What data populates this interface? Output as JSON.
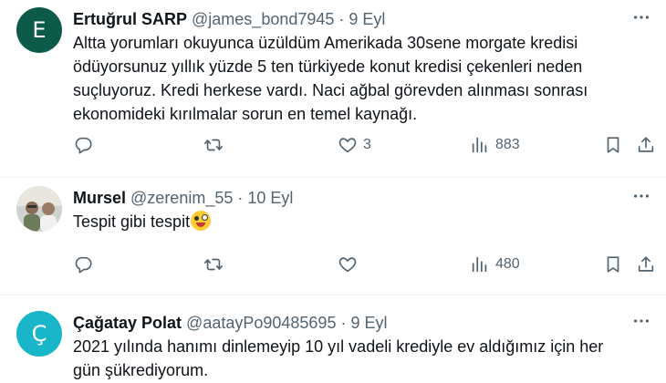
{
  "tweets": [
    {
      "avatar_letter": "E",
      "avatar_color": "#0b5a4a",
      "name": "Ertuğrul SARP",
      "handle": "@james_bond7945",
      "separator": "·",
      "date": "9 Eyl",
      "text_lines": [
        "Altta yorumları okuyunca üzüldüm Amerikada 30sene morgate kredisi",
        "ödüyorsunuz yıllık yüzde 5 ten türkiyede konut kredisi çekenleri neden",
        "suçluyoruz. Kredi herkese vardı.  Naci ağbal görevden alınması sonrası",
        "ekonomideki kırılmalar sorun en temel kaynağı."
      ],
      "likes": "3",
      "views": "883"
    },
    {
      "avatar_icon": "photo-avatar",
      "name": "Mursel",
      "handle": "@zerenim_55",
      "separator": "·",
      "date": "10 Eyl",
      "text": "Tespit gibi tespit",
      "emoji": "zany-face-emoji",
      "likes": "",
      "views": "480"
    },
    {
      "avatar_letter": "Ç",
      "avatar_color": "#19b6c9",
      "name": "Çağatay Polat",
      "handle": "@aatayPo90485695",
      "separator": "·",
      "date": "9 Eyl",
      "text_lines": [
        "2021 yılında hanımı dinlemeyip 10 yıl vadeli krediyle ev aldığımız için her",
        "gün şükrediyorum."
      ]
    }
  ],
  "icons": {
    "reply": "reply-icon",
    "retweet": "retweet-icon",
    "like": "heart-icon",
    "views": "views-icon",
    "bookmark": "bookmark-icon",
    "share": "share-icon",
    "more": "more-icon"
  },
  "colors": {
    "muted": "#536471",
    "divider": "#eff3f4"
  }
}
